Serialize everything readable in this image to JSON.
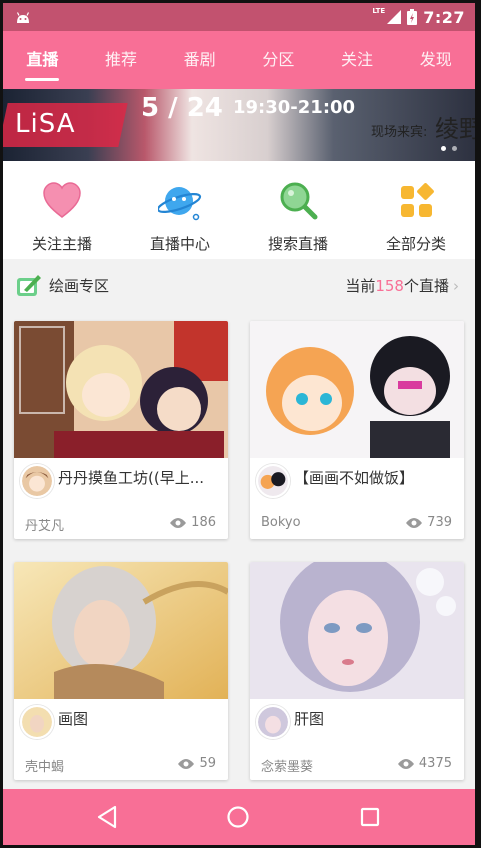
{
  "status_bar": {
    "network": "LTE",
    "time": "7:27"
  },
  "tabs": [
    {
      "label": "直播",
      "active": true
    },
    {
      "label": "推荐",
      "active": false
    },
    {
      "label": "番剧",
      "active": false
    },
    {
      "label": "分区",
      "active": false
    },
    {
      "label": "关注",
      "active": false
    },
    {
      "label": "发现",
      "active": false
    }
  ],
  "banner": {
    "artist": "LiSA",
    "date": "5 / 24",
    "time_range": "19:30-21:00",
    "guest_label": "现场来宾:",
    "guest_name": "绫野"
  },
  "quick_entries": [
    {
      "label": "关注主播",
      "icon": "heart-icon"
    },
    {
      "label": "直播中心",
      "icon": "planet-icon"
    },
    {
      "label": "搜索直播",
      "icon": "search-icon"
    },
    {
      "label": "全部分类",
      "icon": "grid-icon"
    }
  ],
  "section": {
    "title": "绘画专区",
    "count_prefix": "当前",
    "count": "158",
    "count_suffix": "个直播",
    "chevron": "›"
  },
  "cards": [
    {
      "title": "丹丹摸鱼工坊((早上...",
      "user": "丹艾凡",
      "views": "186"
    },
    {
      "title": "【画画不如做饭】",
      "user": "Bokyo",
      "views": "739"
    },
    {
      "title": "画图",
      "user": "壳中蝎",
      "views": "59"
    },
    {
      "title": "肝图",
      "user": "念萦墨葵",
      "views": "4375"
    }
  ],
  "colors": {
    "accent": "#f86f96",
    "status_bar": "#c2526f"
  }
}
